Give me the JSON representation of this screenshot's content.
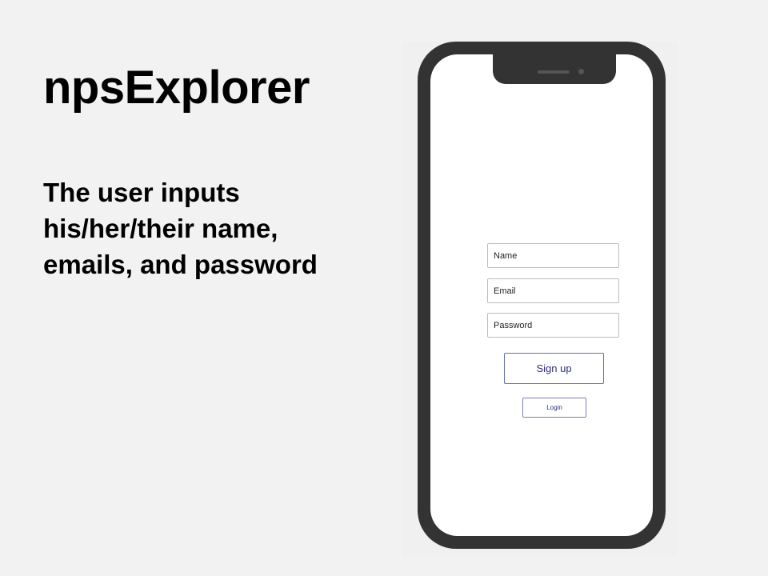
{
  "slide": {
    "title": "npsExplorer",
    "description": "The user inputs his/her/their name, emails, and password"
  },
  "signup_form": {
    "name_placeholder": "Name",
    "email_placeholder": "Email",
    "password_placeholder": "Password",
    "signup_label": "Sign up",
    "login_label": "Login"
  },
  "colors": {
    "slide_background": "#f2f2f2",
    "phone_frame": "#333333",
    "screen_background": "#ffffff",
    "button_border": "#6b6eae",
    "button_text": "#2c2f7a"
  }
}
